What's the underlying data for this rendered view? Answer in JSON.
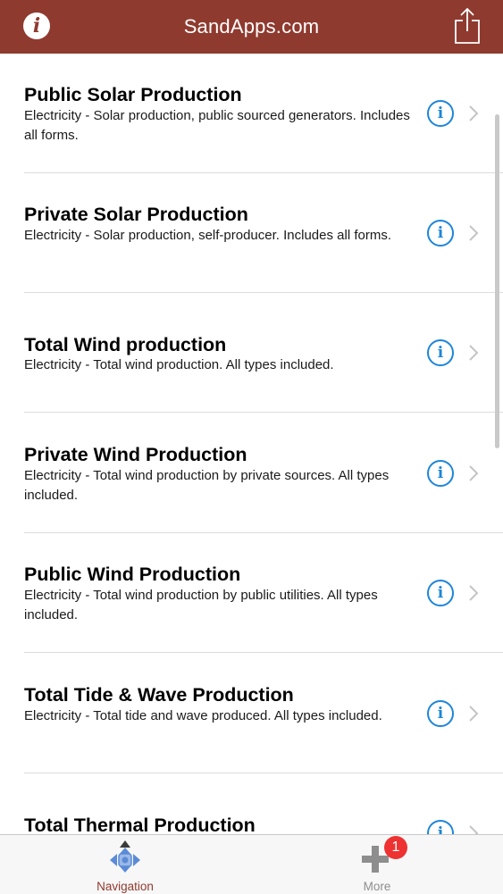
{
  "header": {
    "title": "SandApps.com",
    "info_icon": "info-icon",
    "share_icon": "share-icon",
    "bar_color": "#8f3a2f"
  },
  "items": [
    {
      "title": "Public Solar Production",
      "description": "Electricity - Solar production, public sourced generators. Includes all forms."
    },
    {
      "title": "Private Solar Production",
      "description": "Electricity - Solar production, self-producer. Includes all forms."
    },
    {
      "title": "Total Wind production",
      "description": "Electricity - Total wind production. All types included."
    },
    {
      "title": "Private Wind Production",
      "description": "Electricity - Total wind production by private sources. All types included."
    },
    {
      "title": "Public Wind Production",
      "description": "Electricity - Total wind production by public utilities. All types included."
    },
    {
      "title": "Total Tide & Wave Production",
      "description": "Electricity - Total tide and wave produced. All types included."
    },
    {
      "title": "Total Thermal Production",
      "description": ""
    }
  ],
  "tabbar": {
    "tabs": [
      {
        "label": "Navigation",
        "icon": "navigation-icon",
        "selected": true
      },
      {
        "label": "More",
        "icon": "plus-icon",
        "selected": false
      }
    ],
    "more_badge": "1",
    "active_color": "#8f3a2f",
    "inactive_color": "#8e8e8e"
  }
}
